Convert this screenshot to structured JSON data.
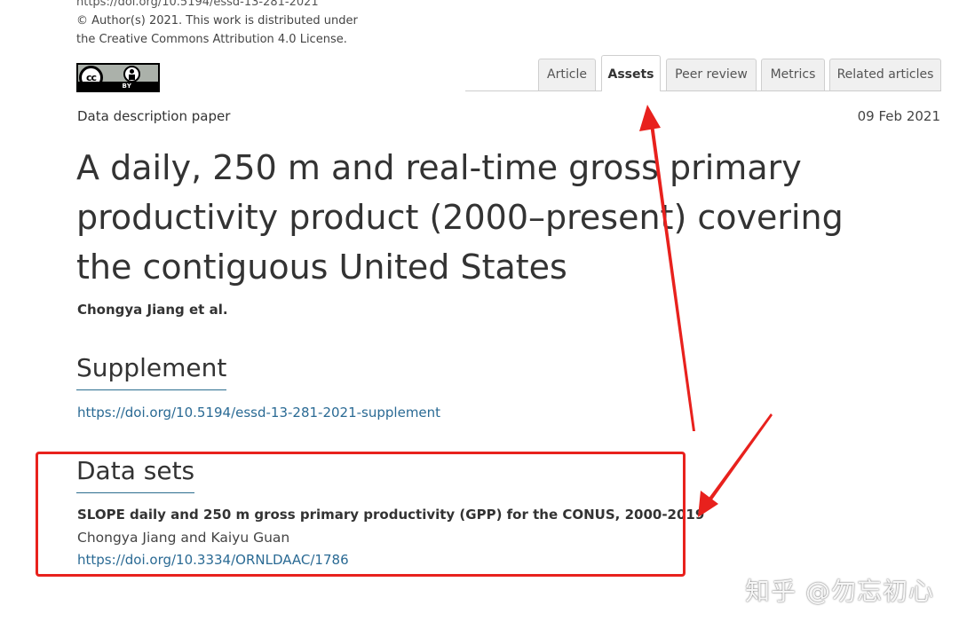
{
  "license": {
    "doi_line": "https://doi.org/10.5194/essd-13-281-2021",
    "copyright_line": "© Author(s) 2021. This work is distributed under",
    "license_line": "the Creative Commons Attribution 4.0 License.",
    "badge_cc": "cc",
    "badge_by": "BY"
  },
  "tabs": [
    {
      "label": "Article",
      "active": false
    },
    {
      "label": "Assets",
      "active": true
    },
    {
      "label": "Peer review",
      "active": false
    },
    {
      "label": "Metrics",
      "active": false
    },
    {
      "label": "Related articles",
      "active": false
    }
  ],
  "paper": {
    "type": "Data description paper",
    "date": "09 Feb 2021",
    "title": "A daily, 250 m and real-time gross primary productivity product (2000–present) covering the contiguous United States",
    "authors": "Chongya Jiang et al."
  },
  "supplement": {
    "heading": "Supplement",
    "link": "https://doi.org/10.5194/essd-13-281-2021-supplement"
  },
  "datasets": {
    "heading": "Data sets",
    "title": "SLOPE daily and 250 m gross primary productivity (GPP) for the CONUS, 2000-2019",
    "authors": "Chongya Jiang and Kaiyu Guan",
    "link": "https://doi.org/10.3334/ORNLDAAC/1786"
  },
  "annotations": {
    "color": "#e8211d"
  },
  "watermark": "知乎 @勿忘初心"
}
